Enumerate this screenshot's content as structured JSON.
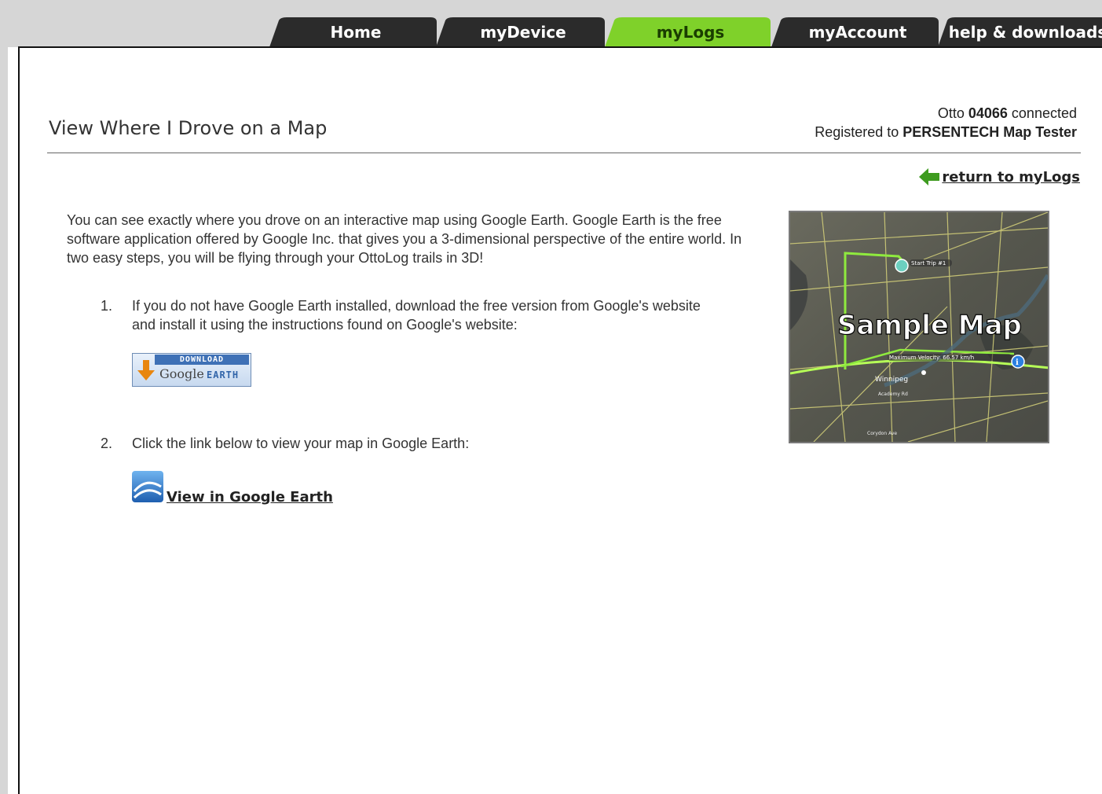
{
  "nav": {
    "tabs": [
      {
        "label": "Home",
        "active": false
      },
      {
        "label": "myDevice",
        "active": false
      },
      {
        "label": "myLogs",
        "active": true
      },
      {
        "label": "myAccount",
        "active": false
      },
      {
        "label": "help & downloads",
        "active": false
      }
    ]
  },
  "colors": {
    "tab_dark": "#2b2b2b",
    "tab_active": "#7fd12a",
    "arrow_green": "#3e9b1f"
  },
  "page": {
    "title": "View Where I Drove on a Map"
  },
  "status": {
    "device_prefix": "Otto",
    "device_id": "04066",
    "device_suffix": "connected",
    "registered_prefix": "Registered to",
    "registered_name": "PERSENTECH Map Tester"
  },
  "return_link": {
    "label": "return to myLogs",
    "icon": "green-arrow-left-icon"
  },
  "intro": "You can see exactly where you drove on an interactive map using Google Earth. Google Earth is the free software application offered by Google Inc. that gives you a 3-dimensional perspective of the entire world. In two easy steps, you will be flying through your OttoLog trails in 3D!",
  "steps": [
    {
      "num": "1.",
      "text": "If you do not have Google Earth installed, download the free version from Google's website and install it using the instructions found on Google's website:"
    },
    {
      "num": "2.",
      "text": "Click the link below to view your map in Google Earth:"
    }
  ],
  "download_button": {
    "top_text": "DOWNLOAD",
    "google_text": "Google",
    "earth_text": "EARTH"
  },
  "view_link": {
    "label": "View in Google Earth",
    "icon": "google-earth-icon"
  },
  "sample_map": {
    "overlay": "Sample Map",
    "labels": {
      "start": "Start Trip #1",
      "velocity": "Maximum Velocity: 66.57 km/h",
      "city": "Winnipeg",
      "street1": "Academy Rd",
      "street2": "Corydon Ave"
    }
  }
}
